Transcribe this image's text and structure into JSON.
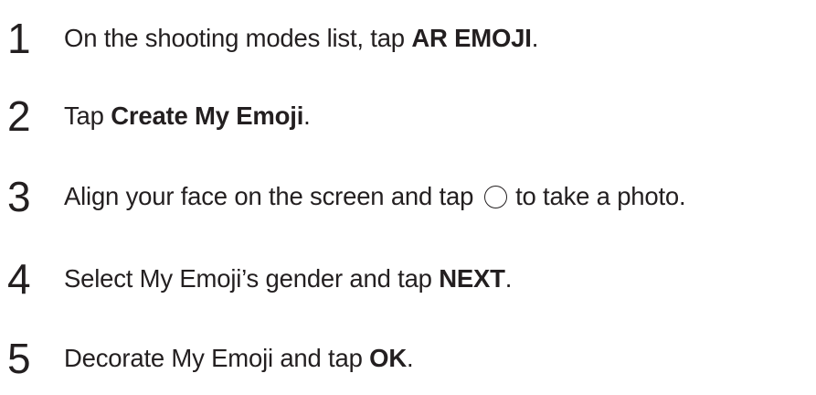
{
  "steps": [
    {
      "number": "1",
      "before": "On the shooting modes list, tap ",
      "bold": "AR EMOJI",
      "after": "."
    },
    {
      "number": "2",
      "before": "Tap ",
      "bold": "Create My Emoji",
      "after": "."
    },
    {
      "number": "3",
      "before": "Align your face on the screen and tap ",
      "icon": "shutter-circle-icon",
      "after": " to take a photo."
    },
    {
      "number": "4",
      "before": "Select My Emoji’s gender and tap ",
      "bold": "NEXT",
      "after": "."
    },
    {
      "number": "5",
      "before": "Decorate My Emoji and tap ",
      "bold": "OK",
      "after": "."
    }
  ]
}
